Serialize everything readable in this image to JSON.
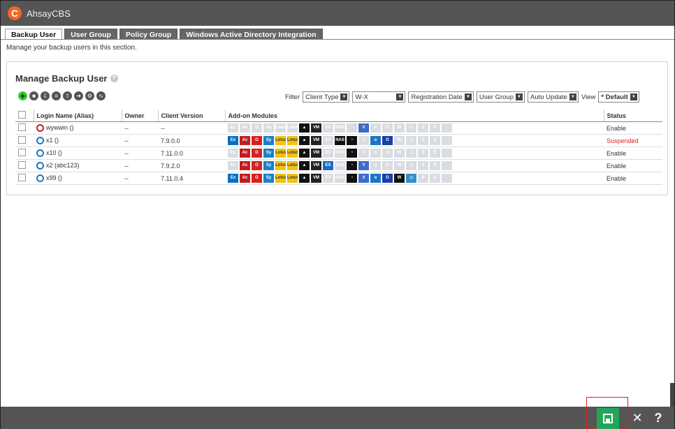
{
  "app": {
    "title": "AhsayCBS",
    "logo_letter": "C",
    "accent": "#f26522"
  },
  "tabs": [
    {
      "label": "Backup User",
      "active": true
    },
    {
      "label": "User Group",
      "active": false
    },
    {
      "label": "Policy Group",
      "active": false
    },
    {
      "label": "Windows Active Directory Integration",
      "active": false
    }
  ],
  "intro": "Manage your backup users in this section.",
  "panel": {
    "title": "Manage Backup User",
    "toolbar": [
      {
        "icon": "add-icon",
        "glyph": "+"
      },
      {
        "icon": "delete-icon",
        "glyph": "■"
      },
      {
        "icon": "import-icon",
        "glyph": "⇩"
      },
      {
        "icon": "batch-edit-icon",
        "glyph": "≡"
      },
      {
        "icon": "upload-icon",
        "glyph": "⇧"
      },
      {
        "icon": "export-icon",
        "glyph": "➜"
      },
      {
        "icon": "user-migrate-icon",
        "glyph": "⚙"
      },
      {
        "icon": "report-icon",
        "glyph": "∿"
      }
    ],
    "filter": {
      "label": "Filter",
      "client_type": "Client Type",
      "range": "W-X",
      "registration_date": "Registration Date",
      "user_group": "User Group",
      "auto_update": "Auto Update",
      "view_label": "View",
      "view": "* Default"
    }
  },
  "table": {
    "headers": [
      "",
      "Login Name (Alias)",
      "Owner",
      "Client Version",
      "Add-on Modules",
      "Status"
    ],
    "rows": [
      {
        "login": "wywwin ()",
        "owner": "--",
        "version": "--",
        "status": "Enable",
        "alert": true,
        "modules": [
          0,
          0,
          0,
          0,
          0,
          0,
          1,
          1,
          0,
          0,
          0,
          1,
          0,
          0,
          0,
          0,
          0,
          0,
          0
        ]
      },
      {
        "login": "x1 ()",
        "owner": "--",
        "version": "7.9.0.0",
        "status": "Suspended",
        "alert": false,
        "modules": [
          1,
          1,
          1,
          1,
          1,
          1,
          1,
          1,
          0,
          1,
          1,
          0,
          1,
          1,
          0,
          0,
          0,
          0,
          0
        ]
      },
      {
        "login": "x10 ()",
        "owner": "--",
        "version": "7.11.0.0",
        "status": "Enable",
        "alert": false,
        "modules": [
          0,
          1,
          1,
          1,
          1,
          1,
          1,
          1,
          0,
          0,
          1,
          0,
          0,
          0,
          0,
          0,
          0,
          0,
          0
        ]
      },
      {
        "login": "x2 (abc123)",
        "owner": "--",
        "version": "7.9.2.0",
        "status": "Enable",
        "alert": false,
        "modules": [
          0,
          1,
          1,
          1,
          1,
          1,
          1,
          1,
          1,
          0,
          1,
          1,
          0,
          0,
          0,
          0,
          0,
          0,
          0
        ]
      },
      {
        "login": "x99 ()",
        "owner": "--",
        "version": "7.11.0.4",
        "status": "Enable",
        "alert": false,
        "modules": [
          1,
          1,
          1,
          1,
          1,
          1,
          1,
          1,
          0,
          0,
          1,
          1,
          1,
          1,
          1,
          1,
          0,
          0,
          0
        ]
      }
    ],
    "module_defs": [
      {
        "label": "Ex",
        "color": "#0a6fc2"
      },
      {
        "label": "Ac",
        "color": "#c21d1d"
      },
      {
        "label": "O",
        "color": "#d7221f"
      },
      {
        "label": "Sy",
        "color": "#1b7fc9"
      },
      {
        "label": "Lotus",
        "color": "#f1c40f"
      },
      {
        "label": "Lotus",
        "color": "#f1c40f"
      },
      {
        "label": "▲",
        "color": "#111111"
      },
      {
        "label": "VM",
        "color": "#222222"
      },
      {
        "label": "EX",
        "color": "#1c6dc4"
      },
      {
        "label": "NAS",
        "color": "#111111"
      },
      {
        "label": "◔",
        "color": "#111111"
      },
      {
        "label": "V",
        "color": "#3b6dc9"
      },
      {
        "label": "o",
        "color": "#1f74c9"
      },
      {
        "label": "O",
        "color": "#1a3fa6"
      },
      {
        "label": "W",
        "color": "#111111"
      },
      {
        "label": "◎",
        "color": "#2f8fcf"
      },
      {
        "label": "S",
        "color": "#4a9fd8"
      },
      {
        "label": "E",
        "color": "#2a6fc0"
      },
      {
        "label": "",
        "color": "#cfd6de"
      }
    ],
    "suspended_color": "#e02020"
  },
  "footer": {
    "save_color": "#22a75a",
    "close_label": "✕",
    "help_label": "?"
  }
}
